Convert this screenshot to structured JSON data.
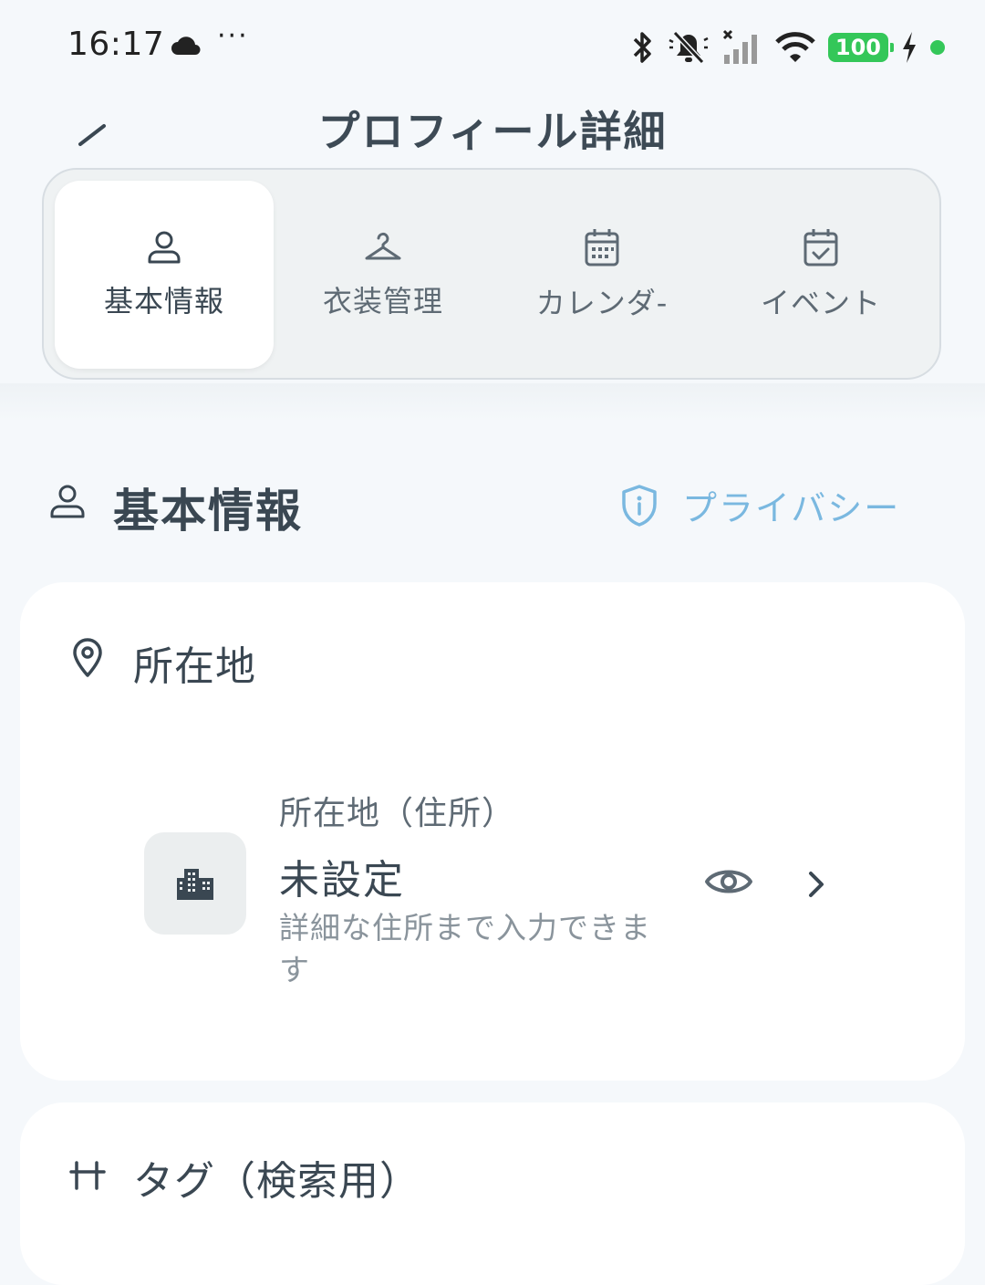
{
  "status_bar": {
    "time": "16:17",
    "dots": "···",
    "battery": "100"
  },
  "header": {
    "title": "プロフィール詳細"
  },
  "tabs": [
    {
      "label": "基本情報",
      "icon": "person-icon",
      "active": true
    },
    {
      "label": "衣装管理",
      "icon": "hanger-icon",
      "active": false
    },
    {
      "label": "カレンダ-",
      "icon": "calendar-icon",
      "active": false
    },
    {
      "label": "イベント",
      "icon": "calendar-check-icon",
      "active": false
    }
  ],
  "section": {
    "title": "基本情報",
    "privacy_label": "プライバシー"
  },
  "location_card": {
    "title": "所在地",
    "field_label": "所在地（住所）",
    "field_value": "未設定",
    "field_help": "詳細な住所まで入力できます"
  },
  "tags_card": {
    "title": "タグ（検索用）"
  },
  "colors": {
    "accent": "#7ab8e0",
    "battery": "#34c759",
    "text": "#3a4752"
  }
}
